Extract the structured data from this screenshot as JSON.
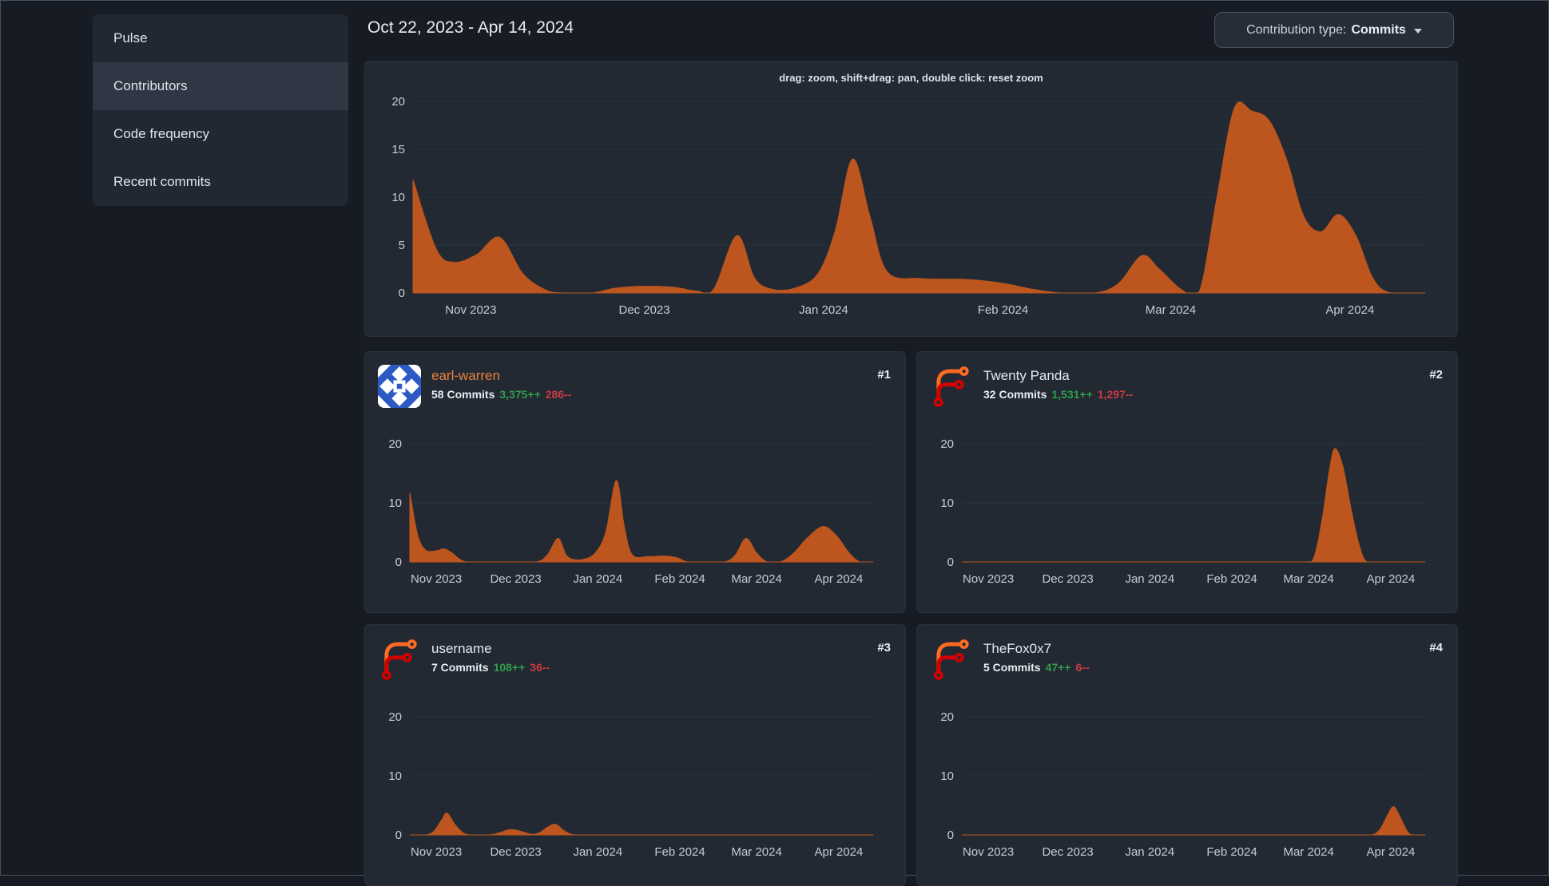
{
  "sidebar": {
    "items": [
      {
        "label": "Pulse",
        "active": false
      },
      {
        "label": "Contributors",
        "active": true
      },
      {
        "label": "Code frequency",
        "active": false
      },
      {
        "label": "Recent commits",
        "active": false
      }
    ]
  },
  "header": {
    "date_range": "Oct 22, 2023 - Apr 14, 2024",
    "contribution_type_label": "Contribution type:",
    "contribution_type_value": "Commits"
  },
  "main_chart_hint": "drag: zoom, shift+drag: pan, double click: reset zoom",
  "contributors": [
    {
      "rank": "#1",
      "name": "earl-warren",
      "name_color": "#e8833d",
      "commits": "58 Commits",
      "additions": "3,375++",
      "deletions": "286--",
      "avatar": "identicon"
    },
    {
      "rank": "#2",
      "name": "Twenty Panda",
      "name_color": "#e4e9ee",
      "commits": "32 Commits",
      "additions": "1,531++",
      "deletions": "1,297--",
      "avatar": "forgejo-logo"
    },
    {
      "rank": "#3",
      "name": "username",
      "name_color": "#e4e9ee",
      "commits": "7 Commits",
      "additions": "108++",
      "deletions": "36--",
      "avatar": "forgejo-logo"
    },
    {
      "rank": "#4",
      "name": "TheFox0x7",
      "name_color": "#e4e9ee",
      "commits": "5 Commits",
      "additions": "47++",
      "deletions": "6--",
      "avatar": "forgejo-logo"
    }
  ],
  "colors": {
    "area_fill": "#bc561e",
    "grid_line": "#2b323d",
    "tick_text": "#c6cdd6",
    "additions_green": "#309e4b",
    "deletions_red": "#cc3b41"
  },
  "chart_data": [
    {
      "id": "all-contributors",
      "type": "area",
      "kind": "main",
      "title": "Commits over time, all contributors",
      "x_axis": {
        "range_dates": [
          "Oct 22, 2023",
          "Apr 14, 2024"
        ],
        "range_days": [
          0,
          175
        ],
        "labels": [
          "Nov 2023",
          "Dec 2023",
          "Jan 2024",
          "Feb 2024",
          "Mar 2024",
          "Apr 2024"
        ],
        "label_days": [
          10,
          40,
          71,
          102,
          131,
          162
        ]
      },
      "y_axis": {
        "ticks": [
          0,
          5,
          10,
          15,
          20
        ],
        "max": 20
      },
      "grid": true,
      "legend": "none",
      "points": [
        [
          0,
          11.8
        ],
        [
          4,
          4.6
        ],
        [
          7,
          3.2
        ],
        [
          11,
          4
        ],
        [
          15,
          5.8
        ],
        [
          19,
          2
        ],
        [
          23,
          0.3
        ],
        [
          26,
          0
        ],
        [
          31,
          0
        ],
        [
          35,
          0.5
        ],
        [
          40,
          0.7
        ],
        [
          45,
          0.6
        ],
        [
          49,
          0.2
        ],
        [
          52,
          0.4
        ],
        [
          56,
          6
        ],
        [
          59,
          1.6
        ],
        [
          62,
          0.4
        ],
        [
          66,
          0.5
        ],
        [
          70,
          2
        ],
        [
          73,
          6.5
        ],
        [
          76,
          14
        ],
        [
          79,
          8
        ],
        [
          82,
          2.2
        ],
        [
          88,
          1.5
        ],
        [
          96,
          1.4
        ],
        [
          102,
          1
        ],
        [
          107,
          0.4
        ],
        [
          112,
          0
        ],
        [
          118,
          0
        ],
        [
          122,
          1
        ],
        [
          126,
          3.9
        ],
        [
          129,
          2.5
        ],
        [
          133,
          0.3
        ],
        [
          136,
          0.2
        ],
        [
          139,
          10
        ],
        [
          142,
          19.3
        ],
        [
          145,
          19
        ],
        [
          148,
          18
        ],
        [
          151,
          14
        ],
        [
          154,
          8
        ],
        [
          157,
          6.4
        ],
        [
          160,
          8.2
        ],
        [
          163,
          6
        ],
        [
          166,
          1.5
        ],
        [
          169,
          0
        ],
        [
          175,
          0
        ]
      ]
    },
    {
      "id": "earl-warren",
      "type": "area",
      "kind": "mini",
      "title": "Commits over time, earl-warren",
      "x_axis": {
        "range_dates": [
          "Oct 22, 2023",
          "Apr 14, 2024"
        ],
        "range_days": [
          0,
          175
        ],
        "labels": [
          "Nov 2023",
          "Dec 2023",
          "Jan 2024",
          "Feb 2024",
          "Mar 2024",
          "Apr 2024"
        ],
        "label_days": [
          10,
          40,
          71,
          102,
          131,
          162
        ]
      },
      "y_axis": {
        "ticks": [
          0,
          10,
          20
        ],
        "max": 20
      },
      "grid": true,
      "legend": "none",
      "points": [
        [
          0,
          11.7
        ],
        [
          3,
          4.5
        ],
        [
          6,
          2
        ],
        [
          10,
          1.9
        ],
        [
          13,
          2.2
        ],
        [
          16,
          1.5
        ],
        [
          19,
          0.4
        ],
        [
          22,
          0
        ],
        [
          30,
          0
        ],
        [
          40,
          0
        ],
        [
          48,
          0
        ],
        [
          52,
          1.2
        ],
        [
          56,
          4
        ],
        [
          59,
          1.2
        ],
        [
          62,
          0.4
        ],
        [
          66,
          0.5
        ],
        [
          70,
          1.5
        ],
        [
          74,
          5
        ],
        [
          78,
          13.8
        ],
        [
          81,
          6
        ],
        [
          84,
          1.2
        ],
        [
          90,
          0.9
        ],
        [
          96,
          1
        ],
        [
          101,
          0.7
        ],
        [
          105,
          0
        ],
        [
          112,
          0
        ],
        [
          119,
          0
        ],
        [
          123,
          1.2
        ],
        [
          127,
          4
        ],
        [
          131,
          1.5
        ],
        [
          135,
          0
        ],
        [
          140,
          0
        ],
        [
          145,
          1.5
        ],
        [
          150,
          4
        ],
        [
          156,
          6
        ],
        [
          161,
          4.5
        ],
        [
          166,
          1.5
        ],
        [
          170,
          0
        ],
        [
          175,
          0
        ]
      ]
    },
    {
      "id": "twenty-panda",
      "type": "area",
      "kind": "mini",
      "title": "Commits over time, Twenty Panda",
      "x_axis": {
        "range_dates": [
          "Oct 22, 2023",
          "Apr 14, 2024"
        ],
        "range_days": [
          0,
          175
        ],
        "labels": [
          "Nov 2023",
          "Dec 2023",
          "Jan 2024",
          "Feb 2024",
          "Mar 2024",
          "Apr 2024"
        ],
        "label_days": [
          10,
          40,
          71,
          102,
          131,
          162
        ]
      },
      "y_axis": {
        "ticks": [
          0,
          10,
          20
        ],
        "max": 20
      },
      "grid": true,
      "legend": "none",
      "points": [
        [
          0,
          0
        ],
        [
          60,
          0
        ],
        [
          120,
          0
        ],
        [
          130,
          0
        ],
        [
          133,
          0.8
        ],
        [
          136,
          7
        ],
        [
          139,
          16
        ],
        [
          141,
          19.2
        ],
        [
          144,
          16
        ],
        [
          147,
          9
        ],
        [
          150,
          3
        ],
        [
          153,
          0
        ],
        [
          160,
          0
        ],
        [
          175,
          0
        ]
      ]
    },
    {
      "id": "username",
      "type": "area",
      "kind": "mini",
      "title": "Commits over time, username",
      "x_axis": {
        "range_dates": [
          "Oct 22, 2023",
          "Apr 14, 2024"
        ],
        "range_days": [
          0,
          175
        ],
        "labels": [
          "Nov 2023",
          "Dec 2023",
          "Jan 2024",
          "Feb 2024",
          "Mar 2024",
          "Apr 2024"
        ],
        "label_days": [
          10,
          40,
          71,
          102,
          131,
          162
        ]
      },
      "y_axis": {
        "ticks": [
          0,
          10,
          20
        ],
        "max": 20
      },
      "grid": true,
      "legend": "none",
      "points": [
        [
          0,
          0
        ],
        [
          6,
          0
        ],
        [
          9,
          0.6
        ],
        [
          12,
          2.5
        ],
        [
          14,
          3.7
        ],
        [
          17,
          1.8
        ],
        [
          20,
          0.4
        ],
        [
          23,
          0
        ],
        [
          30,
          0
        ],
        [
          34,
          0.4
        ],
        [
          38,
          0.9
        ],
        [
          42,
          0.6
        ],
        [
          46,
          0.1
        ],
        [
          49,
          0.4
        ],
        [
          52,
          1.3
        ],
        [
          55,
          1.8
        ],
        [
          58,
          0.8
        ],
        [
          61,
          0.1
        ],
        [
          65,
          0
        ],
        [
          80,
          0
        ],
        [
          120,
          0
        ],
        [
          175,
          0
        ]
      ]
    },
    {
      "id": "thefox0x7",
      "type": "area",
      "kind": "mini",
      "title": "Commits over time, TheFox0x7",
      "x_axis": {
        "range_dates": [
          "Oct 22, 2023",
          "Apr 14, 2024"
        ],
        "range_days": [
          0,
          175
        ],
        "labels": [
          "Nov 2023",
          "Dec 2023",
          "Jan 2024",
          "Feb 2024",
          "Mar 2024",
          "Apr 2024"
        ],
        "label_days": [
          10,
          40,
          71,
          102,
          131,
          162
        ]
      },
      "y_axis": {
        "ticks": [
          0,
          10,
          20
        ],
        "max": 20
      },
      "grid": true,
      "legend": "none",
      "points": [
        [
          0,
          0
        ],
        [
          60,
          0
        ],
        [
          120,
          0
        ],
        [
          150,
          0
        ],
        [
          155,
          0
        ],
        [
          158,
          1
        ],
        [
          161,
          3.5
        ],
        [
          163,
          4.8
        ],
        [
          165,
          3.5
        ],
        [
          168,
          0.8
        ],
        [
          170,
          0
        ],
        [
          175,
          0
        ]
      ]
    }
  ]
}
